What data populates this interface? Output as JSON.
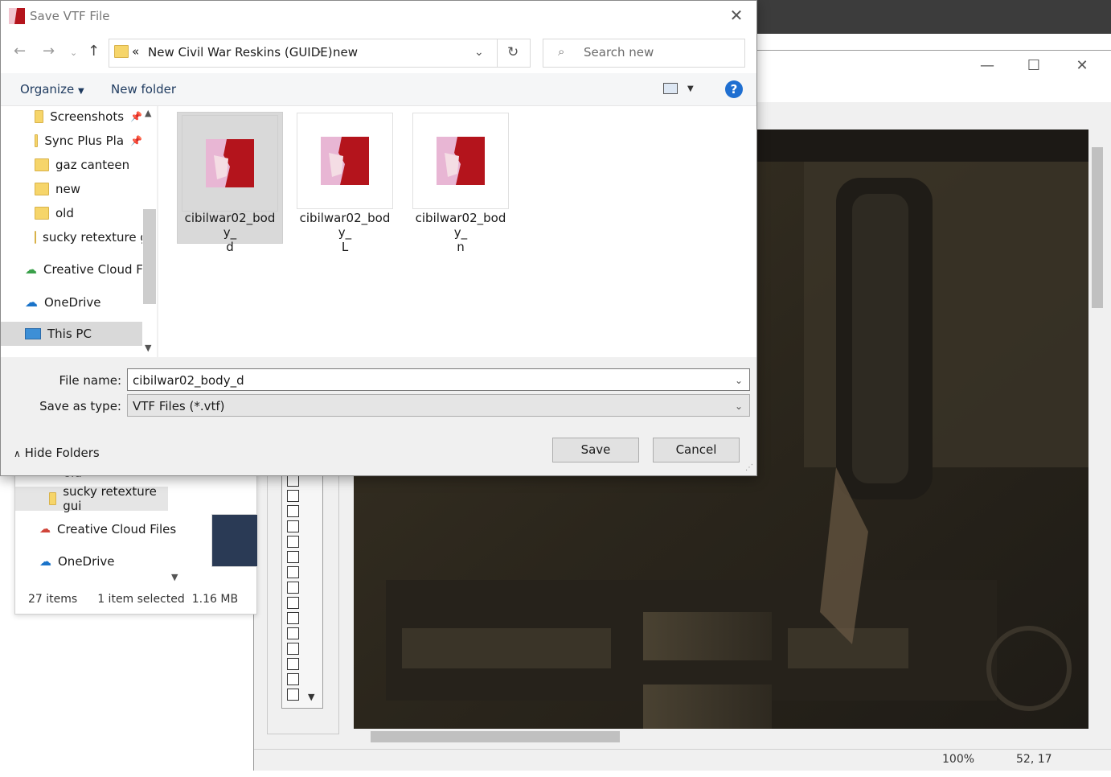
{
  "dialog": {
    "title": "Save VTF File",
    "address": {
      "overflow": "«",
      "crumb1": "New Civil War Reskins (GUIDE)",
      "sep": "›",
      "crumb2": "new"
    },
    "search_placeholder": "Search new",
    "toolbar": {
      "organize": "Organize",
      "new_folder": "New folder"
    },
    "nav_items": [
      {
        "label": "Screenshots",
        "pinned": true
      },
      {
        "label": "Sync Plus Pla",
        "pinned": true
      },
      {
        "label": "gaz canteen"
      },
      {
        "label": "new"
      },
      {
        "label": "old"
      },
      {
        "label": "sucky retexture g"
      },
      {
        "label": "Creative Cloud Fil"
      },
      {
        "label": "OneDrive"
      },
      {
        "label": "This PC"
      }
    ],
    "files": [
      {
        "line1": "cibilwar02_body_",
        "line2": "d"
      },
      {
        "line1": "cibilwar02_body_",
        "line2": "L"
      },
      {
        "line1": "cibilwar02_body_",
        "line2": "n"
      }
    ],
    "filename_label": "File name:",
    "filename_value": "cibilwar02_body_d",
    "savetype_label": "Save as type:",
    "savetype_value": "VTF Files (*.vtf)",
    "hide_folders": "Hide Folders",
    "save": "Save",
    "cancel": "Cancel"
  },
  "explorer": {
    "items": [
      "old",
      "sucky retexture gui",
      "Creative Cloud Files",
      "OneDrive"
    ],
    "item_count": "27 items",
    "selected": "1 item selected",
    "size": "1.16 MB"
  },
  "viewer": {
    "zoom": "100%",
    "coords": "52, 17"
  },
  "colors": {
    "accent": "#1a73c9",
    "help": "#1f6fd1",
    "selection": "#d9d9d9"
  }
}
